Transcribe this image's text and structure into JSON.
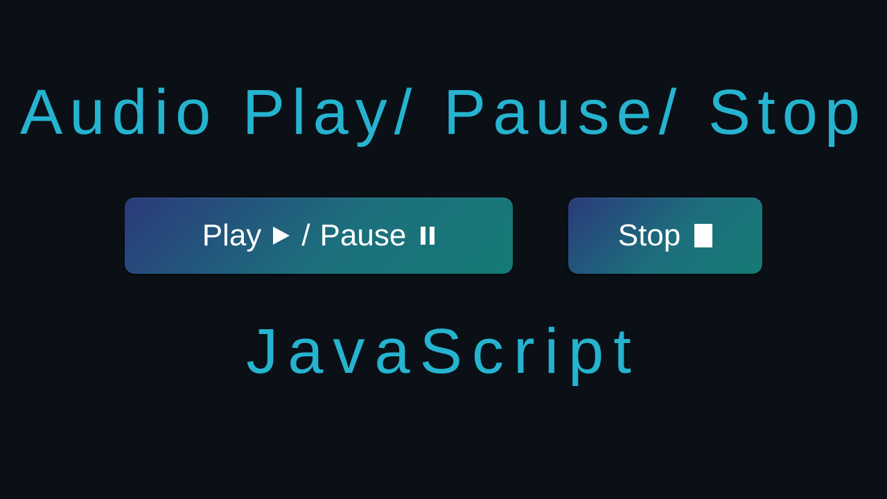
{
  "heading": {
    "title": "Audio Play/ Pause/ Stop",
    "subtitle": "JavaScript"
  },
  "buttons": {
    "play_pause": {
      "label_play": "Play",
      "separator": " / ",
      "label_pause": "Pause"
    },
    "stop": {
      "label": "Stop"
    }
  },
  "colors": {
    "accent": "#26b3cf",
    "background": "#0b1017",
    "button_gradient_start": "#2b3a7a",
    "button_gradient_end": "#167a75",
    "button_text": "#ffffff"
  }
}
